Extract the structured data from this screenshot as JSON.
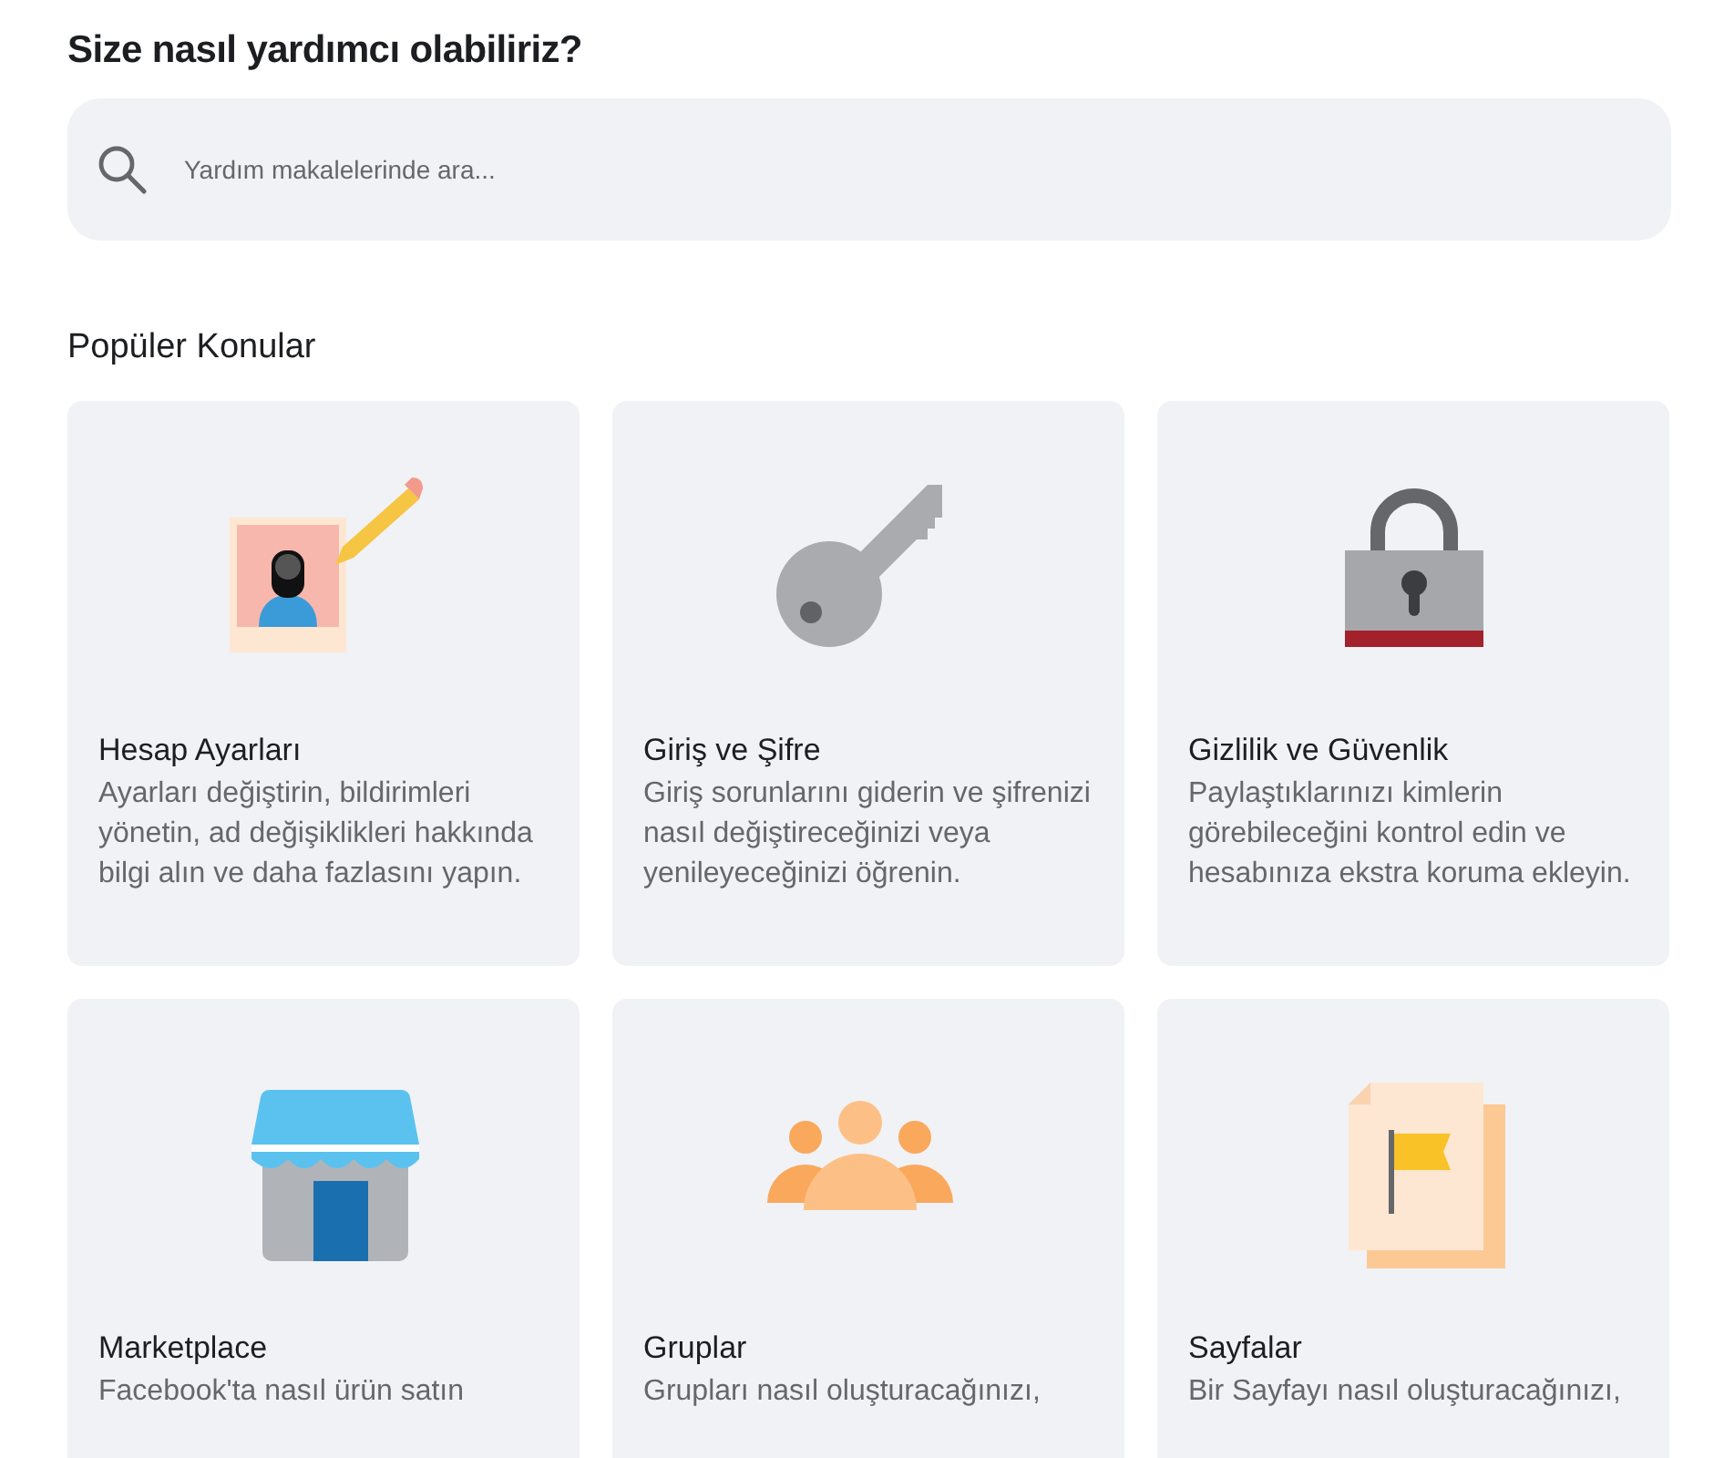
{
  "heading": "Size nasıl yardımcı olabiliriz?",
  "search": {
    "placeholder": "Yardım makalelerinde ara..."
  },
  "section_title": "Popüler Konular",
  "topics": [
    {
      "kind": "profile",
      "title": "Hesap Ayarları",
      "description": "Ayarları değiştirin, bildirimleri yönetin, ad değişiklikleri hakkında bilgi alın ve daha fazlasını yapın."
    },
    {
      "kind": "key",
      "title": "Giriş ve Şifre",
      "description": "Giriş sorunlarını giderin ve şifrenizi nasıl değiştireceğinizi veya yenileyeceğinizi öğrenin."
    },
    {
      "kind": "lock",
      "title": "Gizlilik ve Güvenlik",
      "description": "Paylaştıklarınızı kimlerin görebileceğini kontrol edin ve hesabınıza ekstra koruma ekleyin."
    },
    {
      "kind": "shop",
      "title": "Marketplace",
      "description": "Facebook'ta nasıl ürün satın"
    },
    {
      "kind": "group",
      "title": "Gruplar",
      "description": "Grupları nasıl oluşturacağınızı,"
    },
    {
      "kind": "pages",
      "title": "Sayfalar",
      "description": "Bir Sayfayı nasıl oluşturacağınızı,"
    }
  ]
}
